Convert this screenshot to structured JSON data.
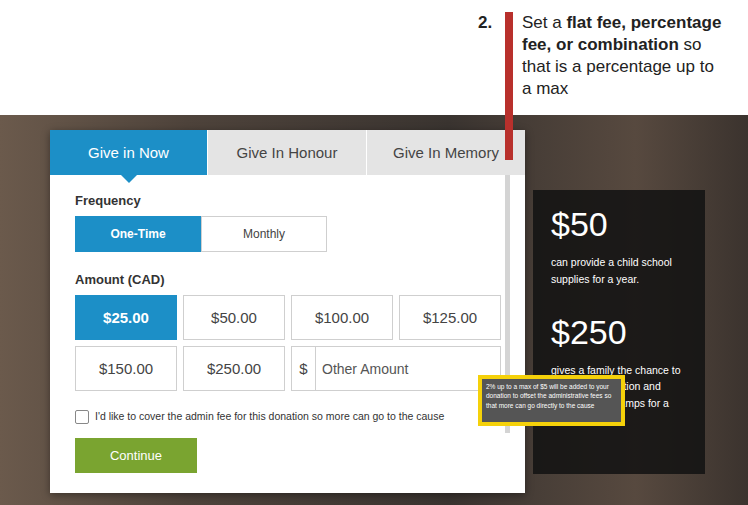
{
  "annotation": {
    "number": "2.",
    "segments": [
      {
        "text": "Set a ",
        "bold": false
      },
      {
        "text": "flat fee, percentage fee, or combination",
        "bold": true
      },
      {
        "text": " so that is a percentage up to a max",
        "bold": false
      }
    ]
  },
  "form": {
    "tabs": [
      {
        "label": "Give in Now",
        "selected": true
      },
      {
        "label": "Give In Honour",
        "selected": false
      },
      {
        "label": "Give In Memory",
        "selected": false
      }
    ],
    "frequency": {
      "label": "Frequency",
      "options": [
        {
          "label": "One-Time",
          "selected": true
        },
        {
          "label": "Monthly",
          "selected": false
        }
      ]
    },
    "amount": {
      "label": "Amount (CAD)",
      "options": [
        {
          "label": "$25.00",
          "selected": true
        },
        {
          "label": "$50.00",
          "selected": false
        },
        {
          "label": "$100.00",
          "selected": false
        },
        {
          "label": "$125.00",
          "selected": false
        },
        {
          "label": "$150.00",
          "selected": false
        },
        {
          "label": "$250.00",
          "selected": false
        }
      ],
      "other": {
        "prefix": "$",
        "placeholder": "Other Amount"
      }
    },
    "admin_fee": {
      "label": "I'd like to cover the admin fee for this donation so more can go to the cause",
      "checked": false,
      "help": "?"
    },
    "continue": "Continue"
  },
  "impact": [
    {
      "amount": "$50",
      "text": "can provide a child school supplies for a year."
    },
    {
      "amount": "$250",
      "text": "gives a family the chance to attend to education and development camps for a"
    }
  ],
  "tooltip": {
    "text": "2% up to a max of $5 will be added to your donation to offset the administrative fees so that more can go directly to the cause"
  }
}
